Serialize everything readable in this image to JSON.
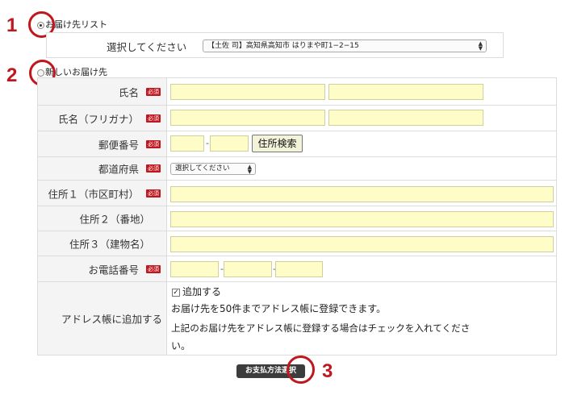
{
  "steps": [
    "1",
    "2",
    "3"
  ],
  "delivery_list": {
    "radio_label": "お届け先リスト",
    "select_label": "選択してください",
    "select_value": "【土佐 司】高知県高知市 はりまや町1−2−15"
  },
  "new_address": {
    "radio_label": "新しいお届け先"
  },
  "required_badge": "必須",
  "fields": {
    "name": "氏名",
    "name_kana": "氏名（フリガナ）",
    "postal_code": "郵便番号",
    "postal_separator": "-",
    "postal_search_button": "住所検索",
    "prefecture": "都道府県",
    "prefecture_select": "選択してください",
    "address1": "住所１（市区町村）",
    "address2": "住所２（番地）",
    "address3": "住所３（建物名）",
    "phone": "お電話番号",
    "phone_separator": "-",
    "add_to_book": "アドレス帳に追加する",
    "add_checkbox_label": "追加する",
    "add_checked": true,
    "add_note_line1": "お届け先を50件までアドレス帳に登録できます。",
    "add_note_line2": "上記のお届け先をアドレス帳に登録する場合はチェックを入れてくださ",
    "add_note_line3": "い。"
  },
  "submit_button": "お支払方法選択",
  "colors": {
    "annotation": "#c0171e",
    "input_fill": "#fefdc8",
    "label_bg": "#f4f4f4",
    "button_dark": "#3c3c3c"
  }
}
